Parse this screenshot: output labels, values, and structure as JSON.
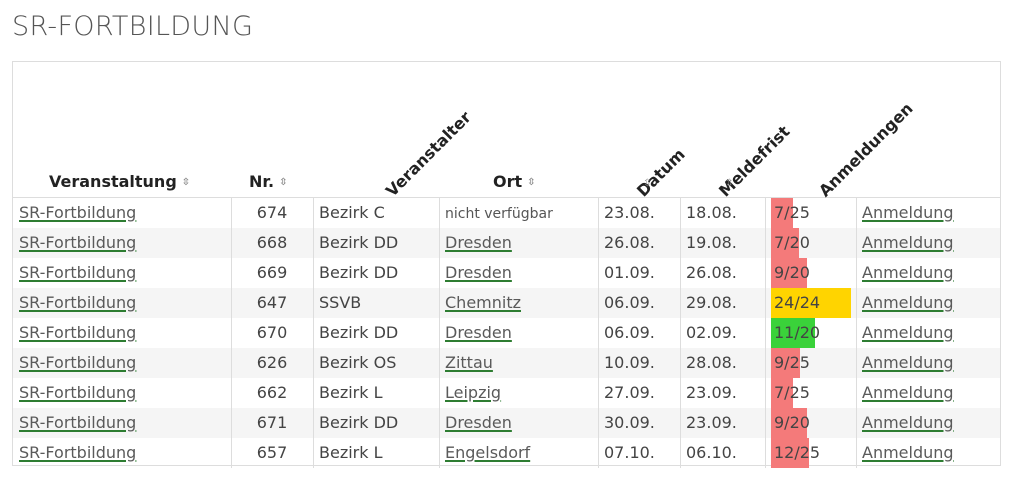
{
  "page": {
    "title": "SR-FORTBILDUNG"
  },
  "table": {
    "columns": {
      "veranstaltung": "Veranstaltung",
      "nr": "Nr.",
      "veranstalter": "Veranstalter",
      "ort": "Ort",
      "datum": "Datum",
      "meldefrist": "Meldefrist",
      "anmeldungen": "Anmeldungen"
    },
    "sort_icon": "sort-up-down-icon",
    "colors": {
      "full": "#ffd400",
      "open": "#3ad23a",
      "low": "#f47a7a"
    },
    "rows": [
      {
        "veranstaltung": "SR-Fortbildung",
        "nr": "674",
        "veranstalter": "Bezirk C",
        "ort": "nicht verfügbar",
        "datum": "23.08.",
        "meldefrist": "18.08.",
        "anmeldungen": "7/25",
        "fill": 0.28,
        "status": "low",
        "action": "Anmeldung"
      },
      {
        "veranstaltung": "SR-Fortbildung",
        "nr": "668",
        "veranstalter": "Bezirk DD",
        "ort": "Dresden",
        "datum": "26.08.",
        "meldefrist": "19.08.",
        "anmeldungen": "7/20",
        "fill": 0.35,
        "status": "low",
        "action": "Anmeldung"
      },
      {
        "veranstaltung": "SR-Fortbildung",
        "nr": "669",
        "veranstalter": "Bezirk DD",
        "ort": "Dresden",
        "datum": "01.09.",
        "meldefrist": "26.08.",
        "anmeldungen": "9/20",
        "fill": 0.45,
        "status": "low",
        "action": "Anmeldung"
      },
      {
        "veranstaltung": "SR-Fortbildung",
        "nr": "647",
        "veranstalter": "SSVB",
        "ort": "Chemnitz",
        "datum": "06.09.",
        "meldefrist": "29.08.",
        "anmeldungen": "24/24",
        "fill": 1.0,
        "status": "full",
        "action": "Anmeldung"
      },
      {
        "veranstaltung": "SR-Fortbildung",
        "nr": "670",
        "veranstalter": "Bezirk DD",
        "ort": "Dresden",
        "datum": "06.09.",
        "meldefrist": "02.09.",
        "anmeldungen": "11/20",
        "fill": 0.55,
        "status": "open",
        "action": "Anmeldung"
      },
      {
        "veranstaltung": "SR-Fortbildung",
        "nr": "626",
        "veranstalter": "Bezirk OS",
        "ort": "Zittau",
        "datum": "10.09.",
        "meldefrist": "28.08.",
        "anmeldungen": "9/25",
        "fill": 0.36,
        "status": "low",
        "action": "Anmeldung"
      },
      {
        "veranstaltung": "SR-Fortbildung",
        "nr": "662",
        "veranstalter": "Bezirk L",
        "ort": "Leipzig",
        "datum": "27.09.",
        "meldefrist": "23.09.",
        "anmeldungen": "7/25",
        "fill": 0.28,
        "status": "low",
        "action": "Anmeldung"
      },
      {
        "veranstaltung": "SR-Fortbildung",
        "nr": "671",
        "veranstalter": "Bezirk DD",
        "ort": "Dresden",
        "datum": "30.09.",
        "meldefrist": "23.09.",
        "anmeldungen": "9/20",
        "fill": 0.45,
        "status": "low",
        "action": "Anmeldung"
      },
      {
        "veranstaltung": "SR-Fortbildung",
        "nr": "657",
        "veranstalter": "Bezirk L",
        "ort": "Engelsdorf",
        "datum": "07.10.",
        "meldefrist": "06.10.",
        "anmeldungen": "12/25",
        "fill": 0.48,
        "status": "low",
        "action": "Anmeldung"
      }
    ]
  }
}
